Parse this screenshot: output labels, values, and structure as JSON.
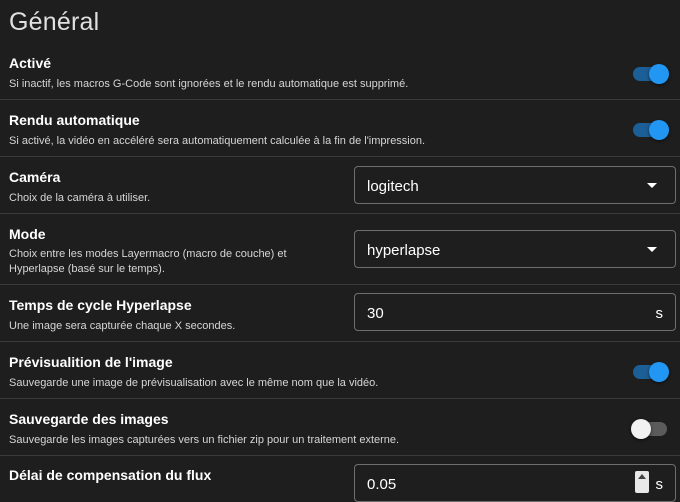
{
  "section": {
    "title": "Général"
  },
  "settings": [
    {
      "title": "Activé",
      "description": "Si inactif, les macros G-Code sont ignorées et le rendu automatique est supprimé.",
      "control": "toggle",
      "on": true
    },
    {
      "title": "Rendu automatique",
      "description": "Si activé, la vidéo en accéléré sera automatiquement calculée à la fin de l'impression.",
      "control": "toggle",
      "on": true
    },
    {
      "title": "Caméra",
      "description": "Choix de la caméra à utiliser.",
      "control": "select",
      "value": "logitech"
    },
    {
      "title": "Mode",
      "description": "Choix entre les modes Layermacro (macro de couche) et Hyperlapse (basé sur le temps).",
      "control": "select",
      "value": "hyperlapse"
    },
    {
      "title": "Temps de cycle Hyperlapse",
      "description": "Une image sera capturée chaque X secondes.",
      "control": "input",
      "value": "30",
      "suffix": "s"
    },
    {
      "title": "Prévisualition de l'image",
      "description": "Sauvegarde une image de prévisualisation avec le même nom que la vidéo.",
      "control": "toggle",
      "on": true
    },
    {
      "title": "Sauvegarde des images",
      "description": "Sauvegarde les images capturées vers un fichier zip pour un traitement externe.",
      "control": "toggle",
      "on": false
    },
    {
      "title": "Délai de compensation du flux",
      "description": "",
      "control": "number",
      "value": "0.05",
      "suffix": "s"
    }
  ],
  "colors": {
    "accent": "#2196f3",
    "background": "#1e1e1e",
    "divider": "#3a3a3a"
  },
  "icons": {
    "dropdown": "caret-down-icon",
    "spinner": "spinner-arrows-icon"
  }
}
